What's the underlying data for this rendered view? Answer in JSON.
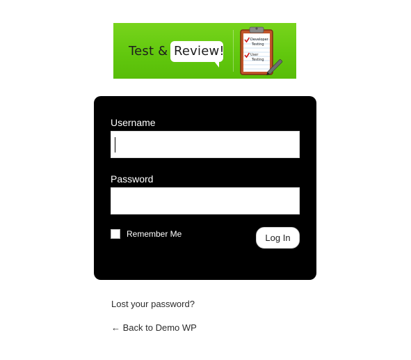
{
  "logo": {
    "text_test": "Test",
    "text_amp": "&",
    "text_review": "Review!",
    "clipboard_line1": "Developer",
    "clipboard_line2": "Testing",
    "clipboard_line3": "User",
    "clipboard_line4": "Testing",
    "brand_green": "#62c80e"
  },
  "form": {
    "username_label": "Username",
    "username_value": "",
    "password_label": "Password",
    "password_value": "",
    "remember_label": "Remember Me",
    "remember_checked": false,
    "login_button": "Log In"
  },
  "links": {
    "lost_password": "Lost your password?",
    "back_to_site": "← Back to Demo WP"
  }
}
